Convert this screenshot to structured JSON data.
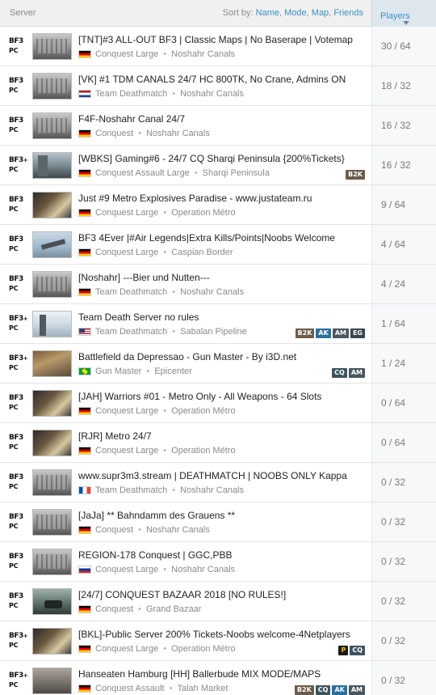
{
  "header": {
    "server_label": "Server",
    "sort_prefix": "Sort by:",
    "sort_name": "Name",
    "sort_mode": "Mode",
    "sort_map": "Map",
    "sort_friends": "Friends",
    "players_label": "Players"
  },
  "platform": {
    "game": "BF3",
    "plus": "+",
    "pc": "PC"
  },
  "rows": [
    {
      "name": "[TNT]#3 ALL-OUT BF3 | Classic Maps | No Baserape | Votemap",
      "flag": "de",
      "mode": "Conquest Large",
      "map": "Noshahr Canals",
      "thumb": "canals",
      "players": "30 / 64",
      "premium": false,
      "tags": []
    },
    {
      "name": "[VK] #1 TDM CANALS 24/7 HC 800TK, No Crane, Admins ON",
      "flag": "nl",
      "mode": "Team Deathmatch",
      "map": "Noshahr Canals",
      "thumb": "canals",
      "players": "18 / 32",
      "premium": false,
      "tags": []
    },
    {
      "name": "F4F-Noshahr Canal 24/7",
      "flag": "de",
      "mode": "Conquest",
      "map": "Noshahr Canals",
      "thumb": "canals",
      "players": "16 / 32",
      "premium": false,
      "tags": []
    },
    {
      "name": "[WBKS] Gaming#6 - 24/7 CQ Sharqi Peninsula {200%Tickets}",
      "flag": "de",
      "mode": "Conquest Assault Large",
      "map": "Sharqi Peninsula",
      "thumb": "sharqi",
      "players": "16 / 32",
      "premium": true,
      "tags": [
        "B2K"
      ]
    },
    {
      "name": "Just #9 Metro Explosives Paradise - www.justateam.ru",
      "flag": "de",
      "mode": "Conquest Large",
      "map": "Operation Métro",
      "thumb": "metro",
      "players": "9 / 64",
      "premium": false,
      "tags": []
    },
    {
      "name": "BF3 4Ever |#Air Legends|Extra Kills/Points|Noobs Welcome",
      "flag": "de",
      "mode": "Conquest Large",
      "map": "Caspian Border",
      "thumb": "caspian",
      "players": "4 / 64",
      "premium": false,
      "tags": []
    },
    {
      "name": "[Noshahr] ---Bier und Nutten---",
      "flag": "de",
      "mode": "Team Deathmatch",
      "map": "Noshahr Canals",
      "thumb": "canals",
      "players": "4 / 24",
      "premium": false,
      "tags": []
    },
    {
      "name": "Team Death Server no rules",
      "flag": "us",
      "mode": "Team Deathmatch",
      "map": "Sabalan Pipeline",
      "thumb": "sabalan",
      "players": "1 / 64",
      "premium": true,
      "tags": [
        "B2K",
        "AK",
        "AM",
        "EG"
      ]
    },
    {
      "name": "Battlefield da Depressao - Gun Master - By i3D.net",
      "flag": "br",
      "mode": "Gun Master",
      "map": "Epicenter",
      "thumb": "epicenter",
      "players": "1 / 24",
      "premium": true,
      "tags": [
        "CQ",
        "AM"
      ]
    },
    {
      "name": "[JAH] Warriors #01 - Metro Only - All Weapons - 64 Slots",
      "flag": "de",
      "mode": "Conquest Large",
      "map": "Operation Métro",
      "thumb": "metro",
      "players": "0 / 64",
      "premium": false,
      "tags": []
    },
    {
      "name": "[RJR] Metro 24/7",
      "flag": "de",
      "mode": "Conquest Large",
      "map": "Operation Métro",
      "thumb": "metro",
      "players": "0 / 64",
      "premium": false,
      "tags": []
    },
    {
      "name": "www.supr3m3.stream | DEATHMATCH | NOOBS ONLY Kappa",
      "flag": "fr",
      "mode": "Team Deathmatch",
      "map": "Noshahr Canals",
      "thumb": "canals",
      "players": "0 / 32",
      "premium": false,
      "tags": []
    },
    {
      "name": "[JaJa] ** Bahndamm des Grauens **",
      "flag": "de",
      "mode": "Conquest",
      "map": "Noshahr Canals",
      "thumb": "canals",
      "players": "0 / 32",
      "premium": false,
      "tags": []
    },
    {
      "name": "REGION-178 Conquest | GGC,PBB",
      "flag": "ru",
      "mode": "Conquest Large",
      "map": "Noshahr Canals",
      "thumb": "canals",
      "players": "0 / 32",
      "premium": false,
      "tags": []
    },
    {
      "name": "[24/7] CONQUEST BAZAAR 2018 [NO RULES!]",
      "flag": "de",
      "mode": "Conquest",
      "map": "Grand Bazaar",
      "thumb": "bazaar",
      "players": "0 / 32",
      "premium": false,
      "tags": []
    },
    {
      "name": "[BKL]-Public Server 200% Tickets-Noobs welcome-4Netplayers",
      "flag": "de",
      "mode": "Conquest Large",
      "map": "Operation Métro",
      "thumb": "metro",
      "players": "0 / 32",
      "premium": true,
      "tags": [
        "P",
        "CQ"
      ]
    },
    {
      "name": "Hanseaten Hamburg [HH] Ballerbude MIX MODE/MAPS",
      "flag": "de",
      "mode": "Conquest Assault",
      "map": "Talah Market",
      "thumb": "talah",
      "players": "0 / 32",
      "premium": true,
      "tags": [
        "B2K",
        "CQ",
        "AK",
        "AM"
      ]
    }
  ]
}
